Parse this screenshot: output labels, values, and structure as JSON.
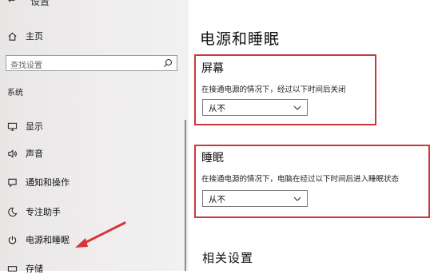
{
  "window": {
    "title": "设置",
    "back_glyph": "←"
  },
  "sidebar": {
    "home_label": "主页",
    "search_placeholder": "查找设置",
    "section_label": "系统",
    "items": [
      {
        "label": "显示",
        "icon": "monitor-icon"
      },
      {
        "label": "声音",
        "icon": "speaker-icon"
      },
      {
        "label": "通知和操作",
        "icon": "notification-icon"
      },
      {
        "label": "专注助手",
        "icon": "moon-icon"
      },
      {
        "label": "电源和睡眠",
        "icon": "power-icon"
      },
      {
        "label": "存储",
        "icon": "storage-icon"
      }
    ]
  },
  "main": {
    "title": "电源和睡眠",
    "screen": {
      "heading": "屏幕",
      "description": "在接通电源的情况下，经过以下时间后关闭",
      "dropdown_value": "从不"
    },
    "sleep": {
      "heading": "睡眠",
      "description": "在接通电源的情况下，电脑在经过以下时间后进入睡眠状态",
      "dropdown_value": "从不"
    },
    "related_settings": "相关设置"
  },
  "colors": {
    "highlight": "#c9393d",
    "sidebar_bg": "#ecebeb"
  }
}
